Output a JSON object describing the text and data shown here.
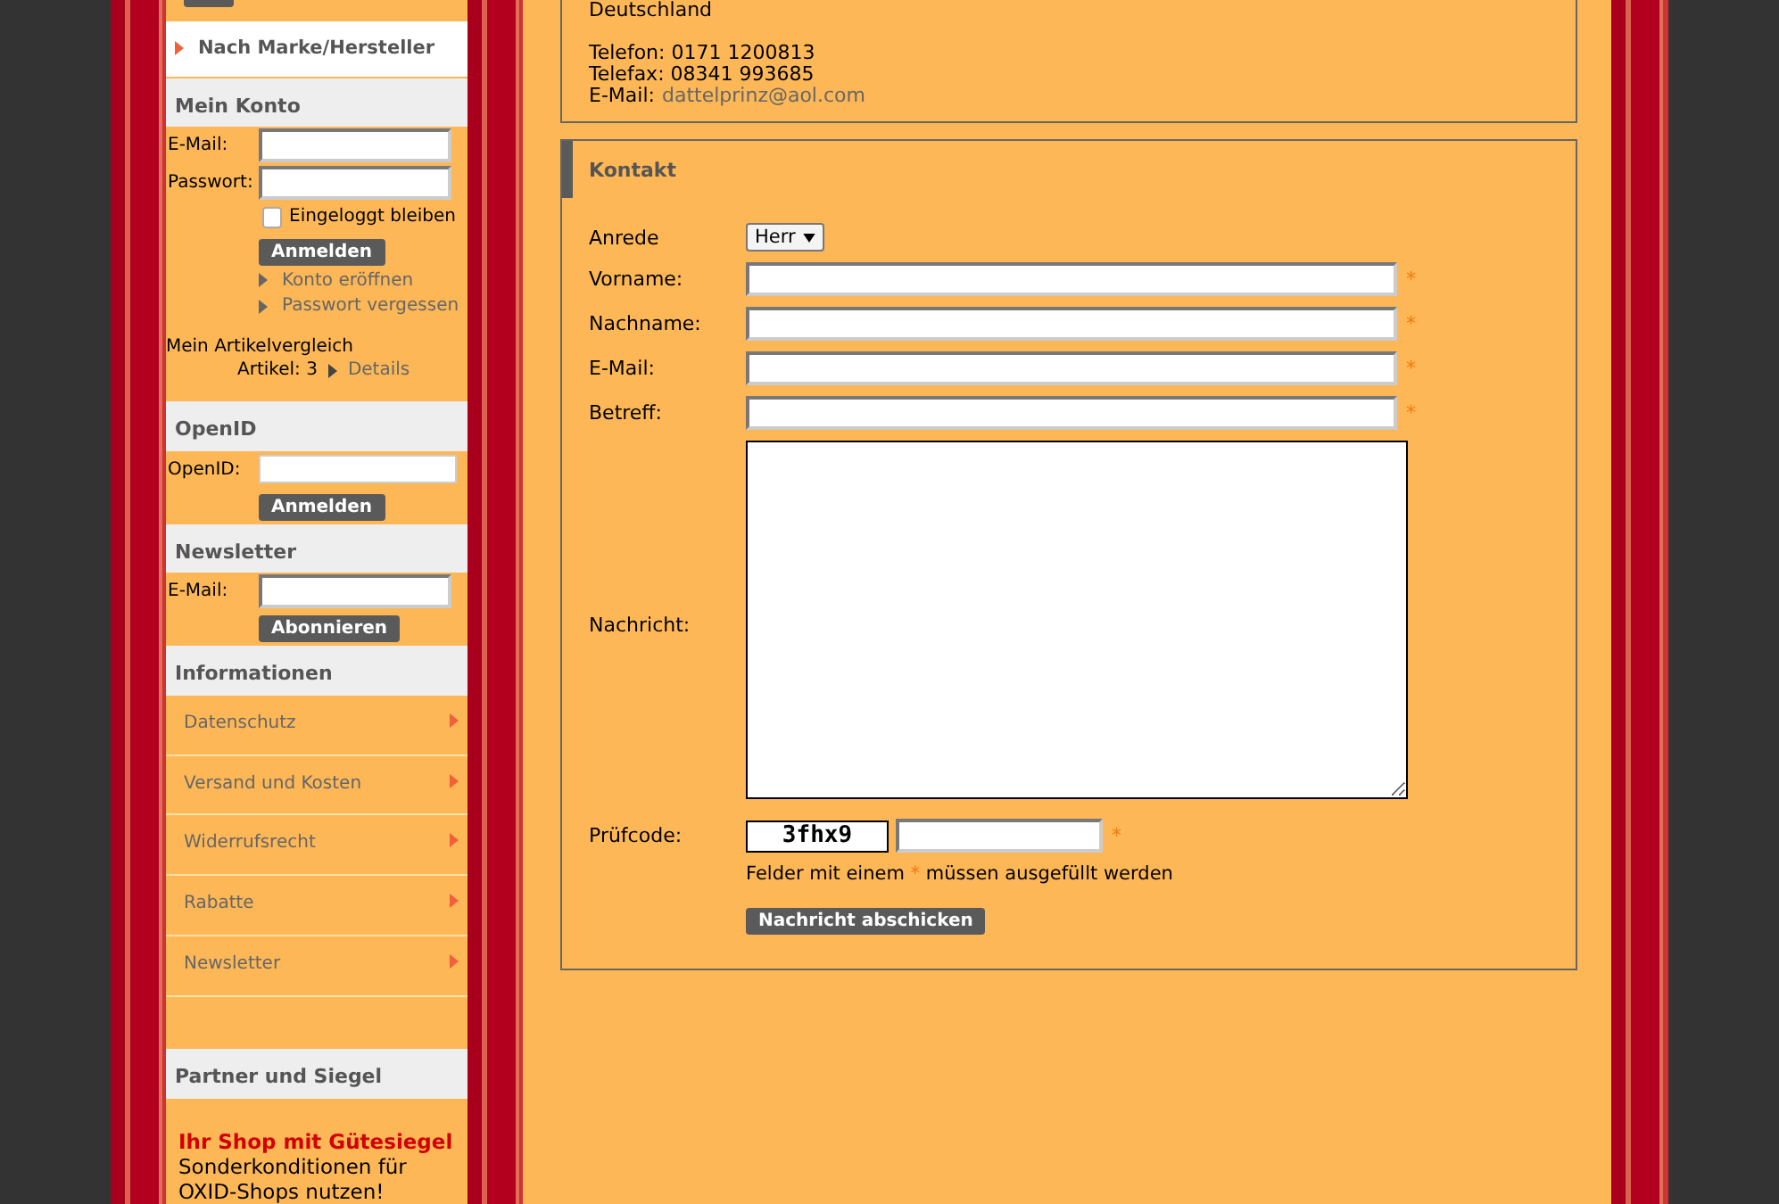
{
  "sidebar": {
    "category_link": "Nach Marke/Hersteller",
    "account": {
      "title": "Mein Konto",
      "email_label": "E-Mail:",
      "password_label": "Passwort:",
      "remember": {
        "label": "Eingeloggt bleiben",
        "checked": false
      },
      "login_button": "Anmelden",
      "links": [
        "Konto eröffnen",
        "Passwort vergessen"
      ],
      "compare_title": "Mein Artikelvergleich",
      "compare_count": "Artikel: 3",
      "compare_link": "Details"
    },
    "openid": {
      "title": "OpenID",
      "label": "OpenID:",
      "button": "Anmelden"
    },
    "newsletter": {
      "title": "Newsletter",
      "label": "E-Mail:",
      "button": "Abonnieren"
    },
    "info": {
      "title": "Informationen",
      "items": [
        "Datenschutz",
        "Versand und Kosten",
        "Widerrufsrecht",
        "Rabatte",
        "Newsletter"
      ]
    },
    "partner": {
      "title": "Partner und Siegel",
      "headline": "Ihr Shop mit Gütesiegel",
      "text": "Sonderkonditionen für",
      "text_cut": "OXID-Shops nutzen!"
    }
  },
  "address": {
    "country": "Deutschland",
    "phone": "Telefon: 0171 1200813",
    "fax": "Telefax: 08341 993685",
    "email_label": "E-Mail:",
    "email": "dattelprinz@aol.com"
  },
  "contact": {
    "title": "Kontakt",
    "salutation_label": "Anrede",
    "salutation": "Herr",
    "fields": [
      {
        "label": "Vorname:",
        "mark": "*"
      },
      {
        "label": "Nachname:",
        "mark": "*"
      },
      {
        "label": "E-Mail:",
        "mark": "*"
      },
      {
        "label": "Betreff:",
        "mark": "*"
      }
    ],
    "message_label": "Nachricht:",
    "captcha_label": "Prüfcode:",
    "captcha_code": "3fhx9",
    "captcha_mark": "*",
    "note_before": "Felder mit einem",
    "note_mark": "*",
    "note_after": "müssen ausgefüllt werden",
    "submit": "Nachricht abschicken"
  }
}
